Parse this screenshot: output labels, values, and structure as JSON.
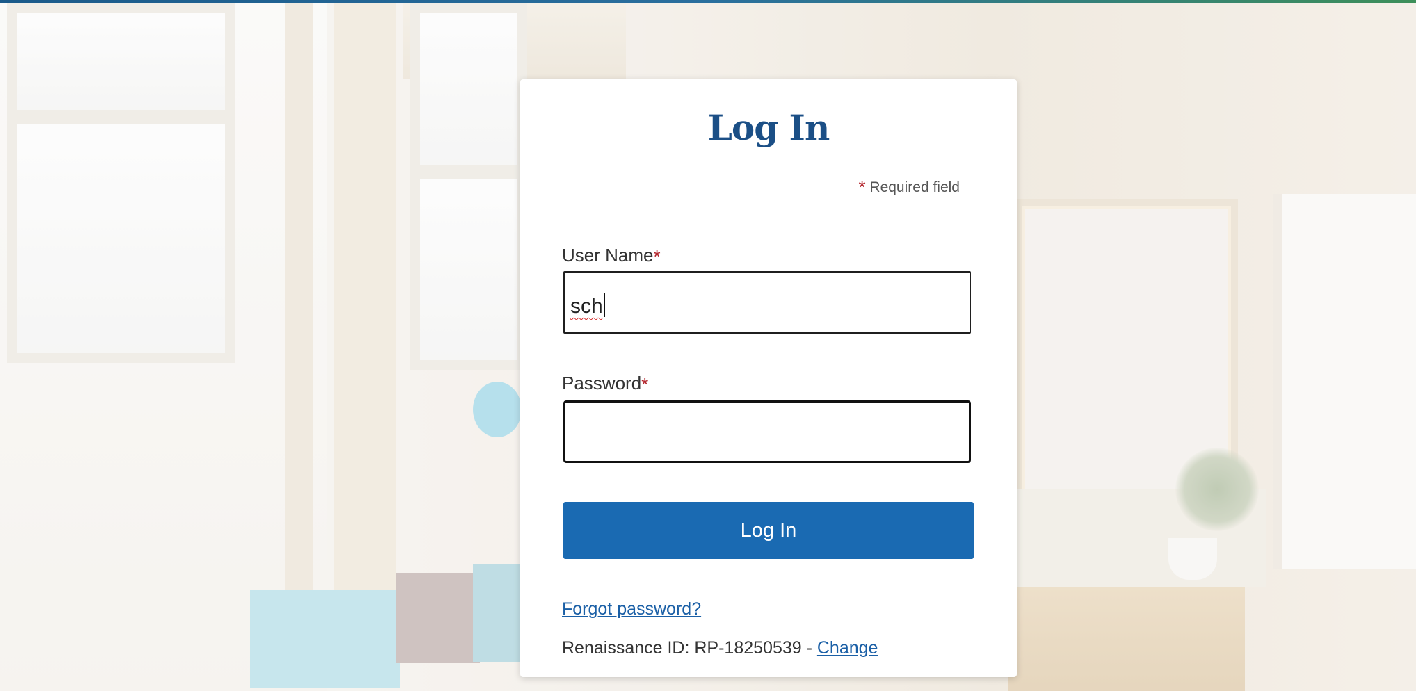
{
  "colors": {
    "title": "#1b4f86",
    "button_bg": "#1a6ab2",
    "button_text": "#ffffff",
    "link": "#1a5fa6",
    "required_star": "#b3242c"
  },
  "login": {
    "title": "Log In",
    "required_star": "*",
    "required_note": "Required field",
    "username": {
      "label": "User Name",
      "required_star": "*",
      "value": "sch"
    },
    "password": {
      "label": "Password",
      "required_star": "*",
      "value": ""
    },
    "submit_label": "Log In",
    "forgot_password_label": "Forgot password?",
    "renaissance_id_prefix": "Renaissance ID: RP-18250539 - ",
    "change_label": "Change"
  }
}
